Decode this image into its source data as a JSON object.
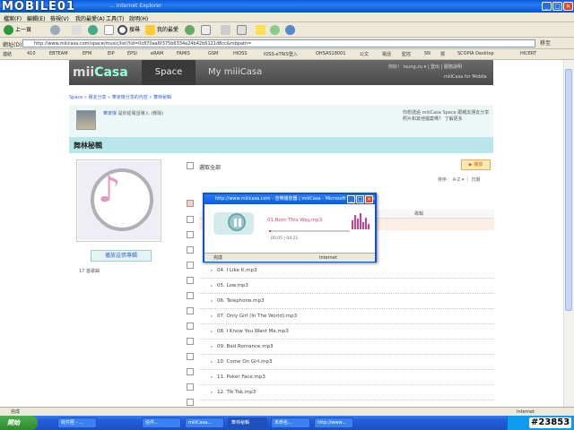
{
  "watermark": "MOBILE01",
  "watermark_id": "#23853",
  "window": {
    "title": "... Internet Explorer"
  },
  "menu": [
    "檔案(F)",
    "編輯(E)",
    "檢視(V)",
    "我的最愛(A)",
    "工具(T)",
    "說明(H)"
  ],
  "toolbar": {
    "back": "上一頁",
    "search": "搜尋",
    "favorites": "我的最愛"
  },
  "address": {
    "label": "網址(D)",
    "url": "http://www.miiicasa.com/space/music/list?lid=0c870aa6f375b6334a24b42b6121d8cc&mbpath=",
    "go": "移至"
  },
  "links": {
    "label": "連結",
    "items": [
      "410",
      "EBTEAM",
      "EFM",
      "EIP",
      "EPSI",
      "eRAM",
      "FAMIS",
      "GSM",
      "HIOSS",
      "IOSS-eTRIS登入",
      "OHSAS18001",
      "公文",
      "電話",
      "監控",
      "SN",
      "標",
      "SCOPIA Desktop",
      "HICERT"
    ]
  },
  "site": {
    "logo_left": "mii",
    "logo_right": "Casa",
    "tab_space": "Space",
    "tab_my": "My miiiCasa",
    "header_right": "你好！ tsung.zu ▾ | 登出 | 服務說明",
    "header_right2": "miiiCasa for Mobile"
  },
  "breadcrumb": "Space » 朋友分享 » 華家傑分享的內容 » 舞林秘輯",
  "user": {
    "name": "華家傑",
    "note": "是你從電話導入 (移除)",
    "right_text": "你想透過 miiiCasa Space 跟親友朋友分享照片和其他檔案嗎？ 了解更多"
  },
  "section": {
    "title": "舞林秘輯"
  },
  "sidebar": {
    "play_album": "播放這張專輯",
    "song_count": "17 首歌曲"
  },
  "list": {
    "select_all": "選取全部",
    "play": "▶ 播放",
    "sort": "排序： A-Z ▾ ｜ 日期",
    "column": "專輯",
    "rows": [
      "04. I Like It.mp3",
      "05. Low.mp3",
      "06. Telephone.mp3",
      "07. Only Girl (In The World).mp3",
      "08. I Know You Want Me.mp3",
      "09. Bad Romance.mp3",
      "10. Come On Girl.mp3",
      "11. Poker Face.mp3",
      "12. Tik Tok.mp3"
    ]
  },
  "popup": {
    "title": "http://www.miiicasa.com - 音樂播放器 | miiiCasa - Microsoft Internet Explorer",
    "track": "01.Born This Way.mp3",
    "time_current": "00:05",
    "time_total": "04:21",
    "progress": 0.02,
    "status_left": "完成",
    "status_right": "Internet"
  },
  "statusbar": {
    "left": "完成",
    "right": "Internet"
  },
  "taskbar": {
    "start": "開始",
    "tasks": [
      "收件匣 - ...",
      "信件...",
      "miiiCasa...",
      "舞林秘輯",
      "未命名...",
      "http://www..."
    ]
  }
}
